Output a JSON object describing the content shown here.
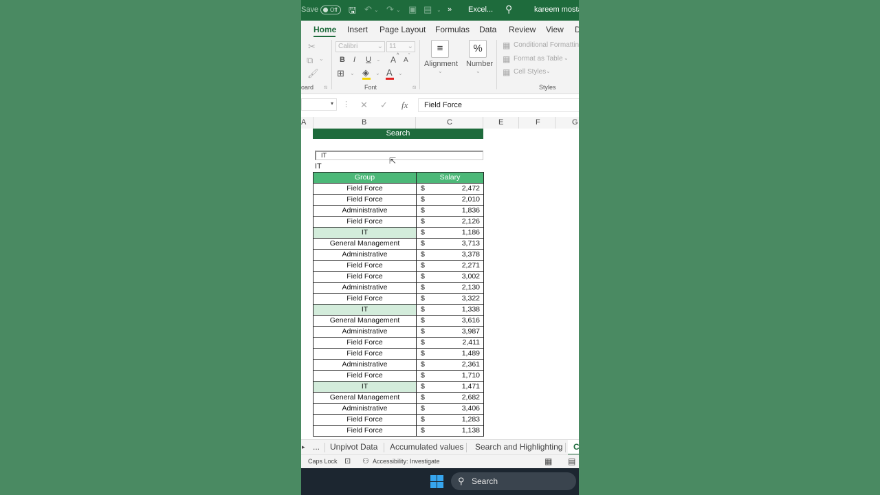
{
  "titlebar": {
    "autosave_label": "Save",
    "autosave_state": "Off",
    "app_title": "Excel...",
    "more": "»",
    "user": "kareem mostaf"
  },
  "ribbon_tabs": [
    "Home",
    "Insert",
    "Page Layout",
    "Formulas",
    "Data",
    "Review",
    "View",
    "D"
  ],
  "ribbon": {
    "font_name": "Calibri",
    "font_size": "11",
    "bold": "B",
    "italic": "I",
    "underline": "U",
    "grow_font": "A",
    "shrink_font": "A",
    "alignment_label": "Alignment",
    "number_label": "Number",
    "number_symbol": "%",
    "conditional_formatting": "Conditional Formattin",
    "format_as_table": "Format as Table",
    "cell_styles": "Cell Styles",
    "group_clipboard": "oard",
    "group_font": "Font",
    "group_styles": "Styles"
  },
  "formula_bar": {
    "fx": "fx",
    "value": "Field Force"
  },
  "columns": [
    "A",
    "B",
    "C",
    "E",
    "F",
    "G"
  ],
  "sheet": {
    "search_header": "Search",
    "search_input": "IT",
    "search_echo": "IT",
    "table_headers": {
      "group": "Group",
      "salary": "Salary"
    },
    "currency": "$",
    "highlight_color": "#d3ecdb",
    "rows": [
      {
        "group": "Field Force",
        "salary": "2,472",
        "hl": false
      },
      {
        "group": "Field Force",
        "salary": "2,010",
        "hl": false
      },
      {
        "group": "Administrative",
        "salary": "1,836",
        "hl": false
      },
      {
        "group": "Field Force",
        "salary": "2,126",
        "hl": false
      },
      {
        "group": "IT",
        "salary": "1,186",
        "hl": true
      },
      {
        "group": "General Management",
        "salary": "3,713",
        "hl": false
      },
      {
        "group": "Administrative",
        "salary": "3,378",
        "hl": false
      },
      {
        "group": "Field Force",
        "salary": "2,271",
        "hl": false
      },
      {
        "group": "Field Force",
        "salary": "3,002",
        "hl": false
      },
      {
        "group": "Administrative",
        "salary": "2,130",
        "hl": false
      },
      {
        "group": "Field Force",
        "salary": "3,322",
        "hl": false
      },
      {
        "group": "IT",
        "salary": "1,338",
        "hl": true
      },
      {
        "group": "General Management",
        "salary": "3,616",
        "hl": false
      },
      {
        "group": "Administrative",
        "salary": "3,987",
        "hl": false
      },
      {
        "group": "Field Force",
        "salary": "2,411",
        "hl": false
      },
      {
        "group": "Field Force",
        "salary": "1,489",
        "hl": false
      },
      {
        "group": "Administrative",
        "salary": "2,361",
        "hl": false
      },
      {
        "group": "Field Force",
        "salary": "1,710",
        "hl": false
      },
      {
        "group": "IT",
        "salary": "1,471",
        "hl": true
      },
      {
        "group": "General Management",
        "salary": "2,682",
        "hl": false
      },
      {
        "group": "Administrative",
        "salary": "3,406",
        "hl": false
      },
      {
        "group": "Field Force",
        "salary": "1,283",
        "hl": false
      },
      {
        "group": "Field Force",
        "salary": "1,138",
        "hl": false
      }
    ]
  },
  "sheet_tabs": {
    "more": "...",
    "tabs": [
      "Unpivot Data",
      "Accumulated values",
      "Search and Highlighting",
      "C"
    ]
  },
  "status": {
    "caps_lock": "Caps Lock",
    "accessibility": "Accessibility: Investigate"
  },
  "taskbar": {
    "search": "Search"
  },
  "colors": {
    "excel_green": "#1e6b3c",
    "header_green": "#4cb878",
    "background": "#4a8a62"
  }
}
